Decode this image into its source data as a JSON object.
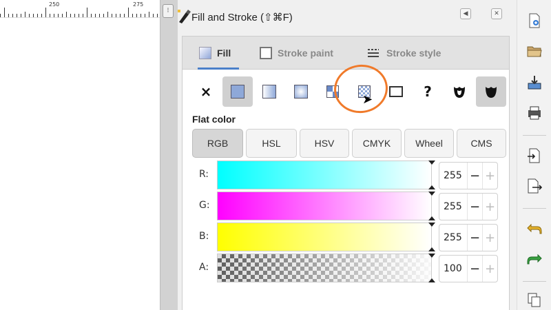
{
  "ruler": {
    "labels": [
      "250",
      "275"
    ]
  },
  "dialog": {
    "title": "Fill and Stroke (⇧⌘F)",
    "tabs": [
      {
        "label": "Fill",
        "icon": "fill-tab-icon"
      },
      {
        "label": "Stroke paint",
        "icon": "stroke-paint-tab-icon"
      },
      {
        "label": "Stroke style",
        "icon": "stroke-style-tab-icon"
      }
    ],
    "paint_types": [
      {
        "name": "no-paint",
        "glyph": "×"
      },
      {
        "name": "flat-color",
        "glyph": ""
      },
      {
        "name": "linear-gradient",
        "glyph": ""
      },
      {
        "name": "radial-gradient",
        "glyph": ""
      },
      {
        "name": "mesh-gradient",
        "glyph": ""
      },
      {
        "name": "pattern",
        "glyph": ""
      },
      {
        "name": "swatch",
        "glyph": ""
      },
      {
        "name": "unset-paint",
        "glyph": "?"
      },
      {
        "name": "fill-rule-evenodd",
        "glyph": ""
      },
      {
        "name": "fill-rule-nonzero",
        "glyph": ""
      }
    ],
    "section_label": "Flat color",
    "modes": [
      "RGB",
      "HSL",
      "HSV",
      "CMYK",
      "Wheel",
      "CMS"
    ],
    "selected_mode": "RGB",
    "channels": [
      {
        "label": "R:",
        "value": "255",
        "minus": "−",
        "plus": "+"
      },
      {
        "label": "G:",
        "value": "255",
        "minus": "−",
        "plus": "+"
      },
      {
        "label": "B:",
        "value": "255",
        "minus": "−",
        "plus": "+"
      },
      {
        "label": "A:",
        "value": "100",
        "minus": "−",
        "plus": "+"
      }
    ]
  },
  "colors": {
    "accent": "#4a7fc9",
    "annotation": "#f07a2a",
    "red_slider_start": "#00ffff",
    "green_slider_start": "#ff00ff",
    "blue_slider_start": "#ffff00"
  }
}
